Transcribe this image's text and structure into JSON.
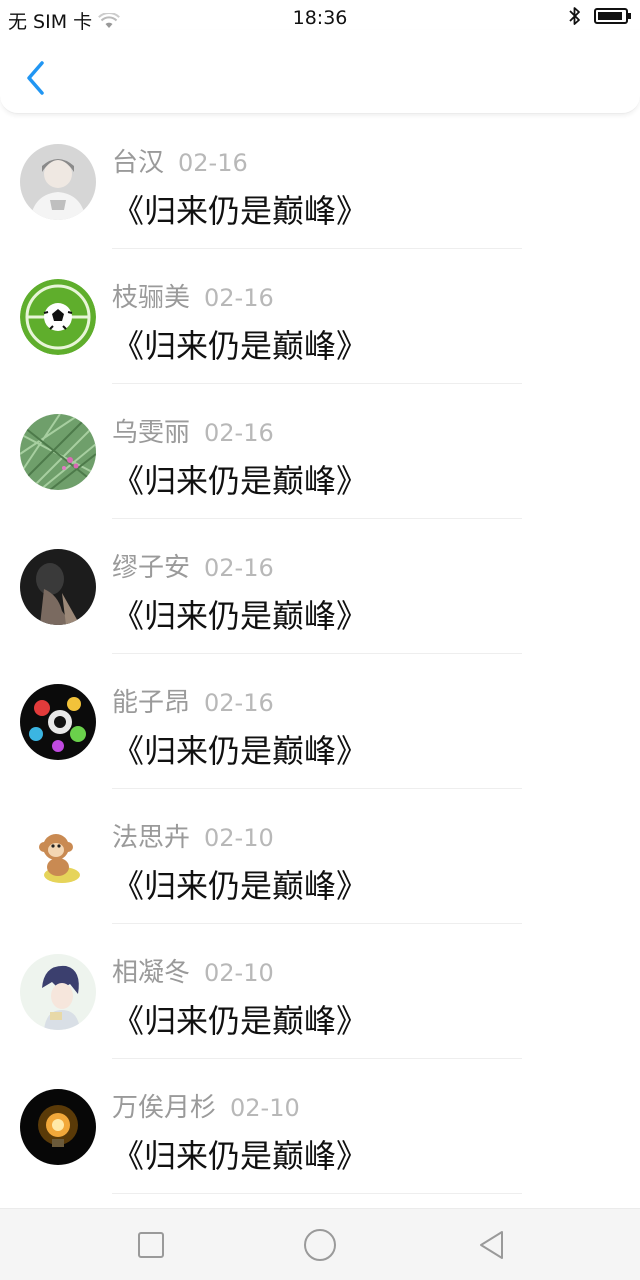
{
  "status_bar": {
    "carrier": "无 SIM 卡",
    "time": "18:36"
  },
  "header": {
    "back_icon": "chevron-left-icon",
    "accent_color": "#2196f3"
  },
  "messages": [
    {
      "name": "台汉",
      "date": "02-16",
      "text": "《归来仍是巅峰》",
      "avatar": "photo-girl"
    },
    {
      "name": "枝骊美",
      "date": "02-16",
      "text": "《归来仍是巅峰》",
      "avatar": "soccer-ball"
    },
    {
      "name": "乌雯丽",
      "date": "02-16",
      "text": "《归来仍是巅峰》",
      "avatar": "plants"
    },
    {
      "name": "缪子安",
      "date": "02-16",
      "text": "《归来仍是巅峰》",
      "avatar": "dark-portrait"
    },
    {
      "name": "能子昂",
      "date": "02-16",
      "text": "《归来仍是巅峰》",
      "avatar": "colorful-splash"
    },
    {
      "name": "法思卉",
      "date": "02-10",
      "text": "《归来仍是巅峰》",
      "avatar": "cartoon-monkey"
    },
    {
      "name": "相凝冬",
      "date": "02-10",
      "text": "《归来仍是巅峰》",
      "avatar": "anime-character"
    },
    {
      "name": "万俟月杉",
      "date": "02-10",
      "text": "《归来仍是巅峰》",
      "avatar": "light-bulb"
    }
  ],
  "nav_bar": {
    "recent_icon": "square-icon",
    "home_icon": "circle-icon",
    "back_icon": "triangle-back-icon"
  }
}
